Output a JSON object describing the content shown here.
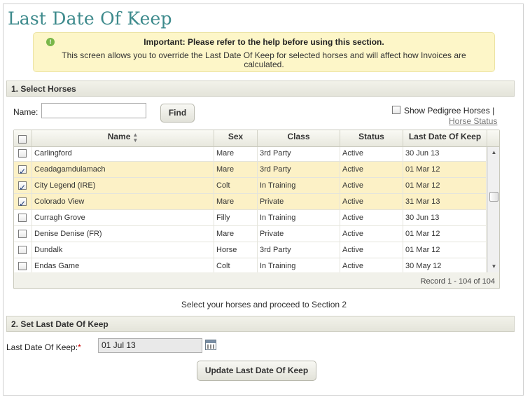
{
  "page": {
    "title": "Last Date Of Keep"
  },
  "notice": {
    "title": "Important: Please refer to the help before using this section.",
    "text": "This screen allows you to override the Last Date Of Keep for selected horses and will affect how Invoices are calculated."
  },
  "section1": {
    "title": "1. Select Horses",
    "name_label": "Name:",
    "name_value": "",
    "find_label": "Find",
    "show_pedigree_label": "Show Pedigree Horses |",
    "horse_status_link": "Horse Status"
  },
  "grid": {
    "columns": [
      "Name",
      "Sex",
      "Class",
      "Status",
      "Last Date Of Keep"
    ],
    "rows": [
      {
        "name": "Carlingford",
        "sex": "Mare",
        "class": "3rd Party",
        "status": "Active",
        "ldk": "30 Jun 13",
        "checked": false
      },
      {
        "name": "Ceadagamdulamach",
        "sex": "Mare",
        "class": "3rd Party",
        "status": "Active",
        "ldk": "01 Mar 12",
        "checked": true
      },
      {
        "name": "City Legend (IRE)",
        "sex": "Colt",
        "class": "In Training",
        "status": "Active",
        "ldk": "01 Mar 12",
        "checked": true
      },
      {
        "name": "Colorado View",
        "sex": "Mare",
        "class": "Private",
        "status": "Active",
        "ldk": "31 Mar 13",
        "checked": true
      },
      {
        "name": "Curragh Grove",
        "sex": "Filly",
        "class": "In Training",
        "status": "Active",
        "ldk": "30 Jun 13",
        "checked": false
      },
      {
        "name": "Denise Denise (FR)",
        "sex": "Mare",
        "class": "Private",
        "status": "Active",
        "ldk": "01 Mar 12",
        "checked": false
      },
      {
        "name": "Dundalk",
        "sex": "Horse",
        "class": "3rd Party",
        "status": "Active",
        "ldk": "01 Mar 12",
        "checked": false
      },
      {
        "name": "Endas Game",
        "sex": "Colt",
        "class": "In Training",
        "status": "Active",
        "ldk": "30 May 12",
        "checked": false
      }
    ],
    "record_text": "Record 1 - 104 of 104"
  },
  "select_message": "Select your horses and proceed to Section 2",
  "section2": {
    "title": "2. Set Last Date Of Keep",
    "ldk_label": "Last Date Of Keep:",
    "required_mark": "*",
    "ldk_value": "01 Jul 13",
    "update_label": "Update Last Date Of Keep"
  }
}
